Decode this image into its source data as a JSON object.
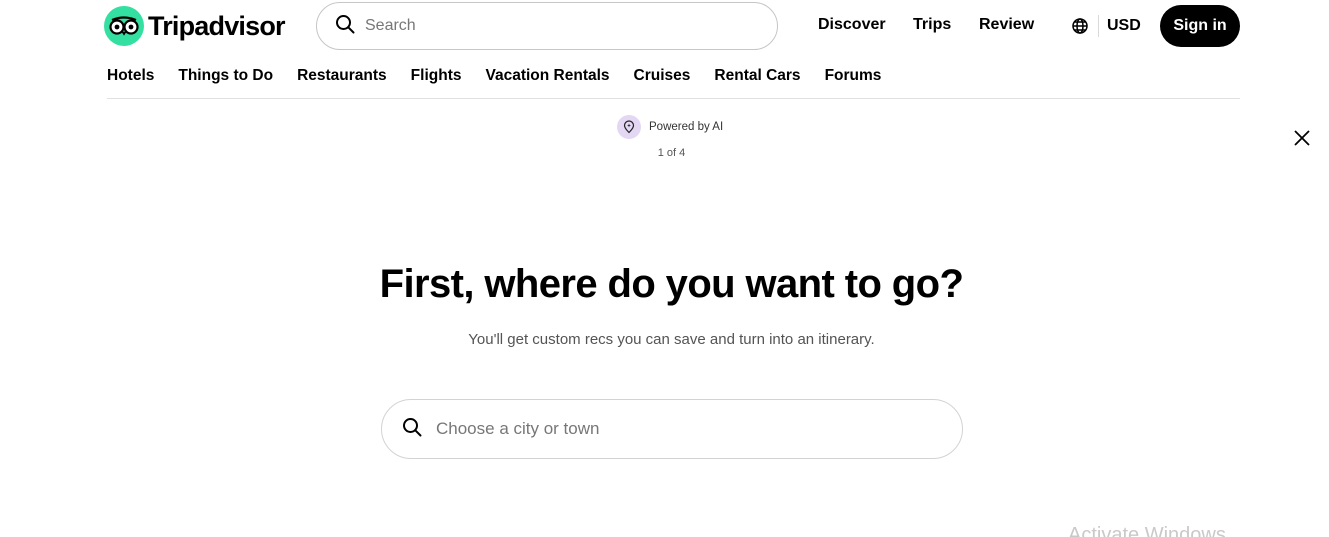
{
  "header": {
    "brand": "Tripadvisor",
    "search_placeholder": "Search",
    "nav": {
      "discover": "Discover",
      "trips": "Trips",
      "review": "Review"
    },
    "currency": "USD",
    "signin_label": "Sign in"
  },
  "categories": [
    "Hotels",
    "Things to Do",
    "Restaurants",
    "Flights",
    "Vacation Rentals",
    "Cruises",
    "Rental Cars",
    "Forums"
  ],
  "ai_badge": {
    "label": "Powered by AI",
    "step": "1 of 4"
  },
  "main": {
    "headline": "First, where do you want to go?",
    "subtitle": "You'll get custom recs you can save and turn into an itinerary.",
    "city_placeholder": "Choose a city or town"
  },
  "watermark": "Activate Windows",
  "colors": {
    "brand_green": "#34e0a1",
    "signin_bg": "#000000",
    "ai_badge_bg": "#e3d7f3"
  },
  "icons": [
    "owl-logo-icon",
    "search-icon",
    "globe-icon",
    "sparkle-pin-icon",
    "close-icon"
  ]
}
